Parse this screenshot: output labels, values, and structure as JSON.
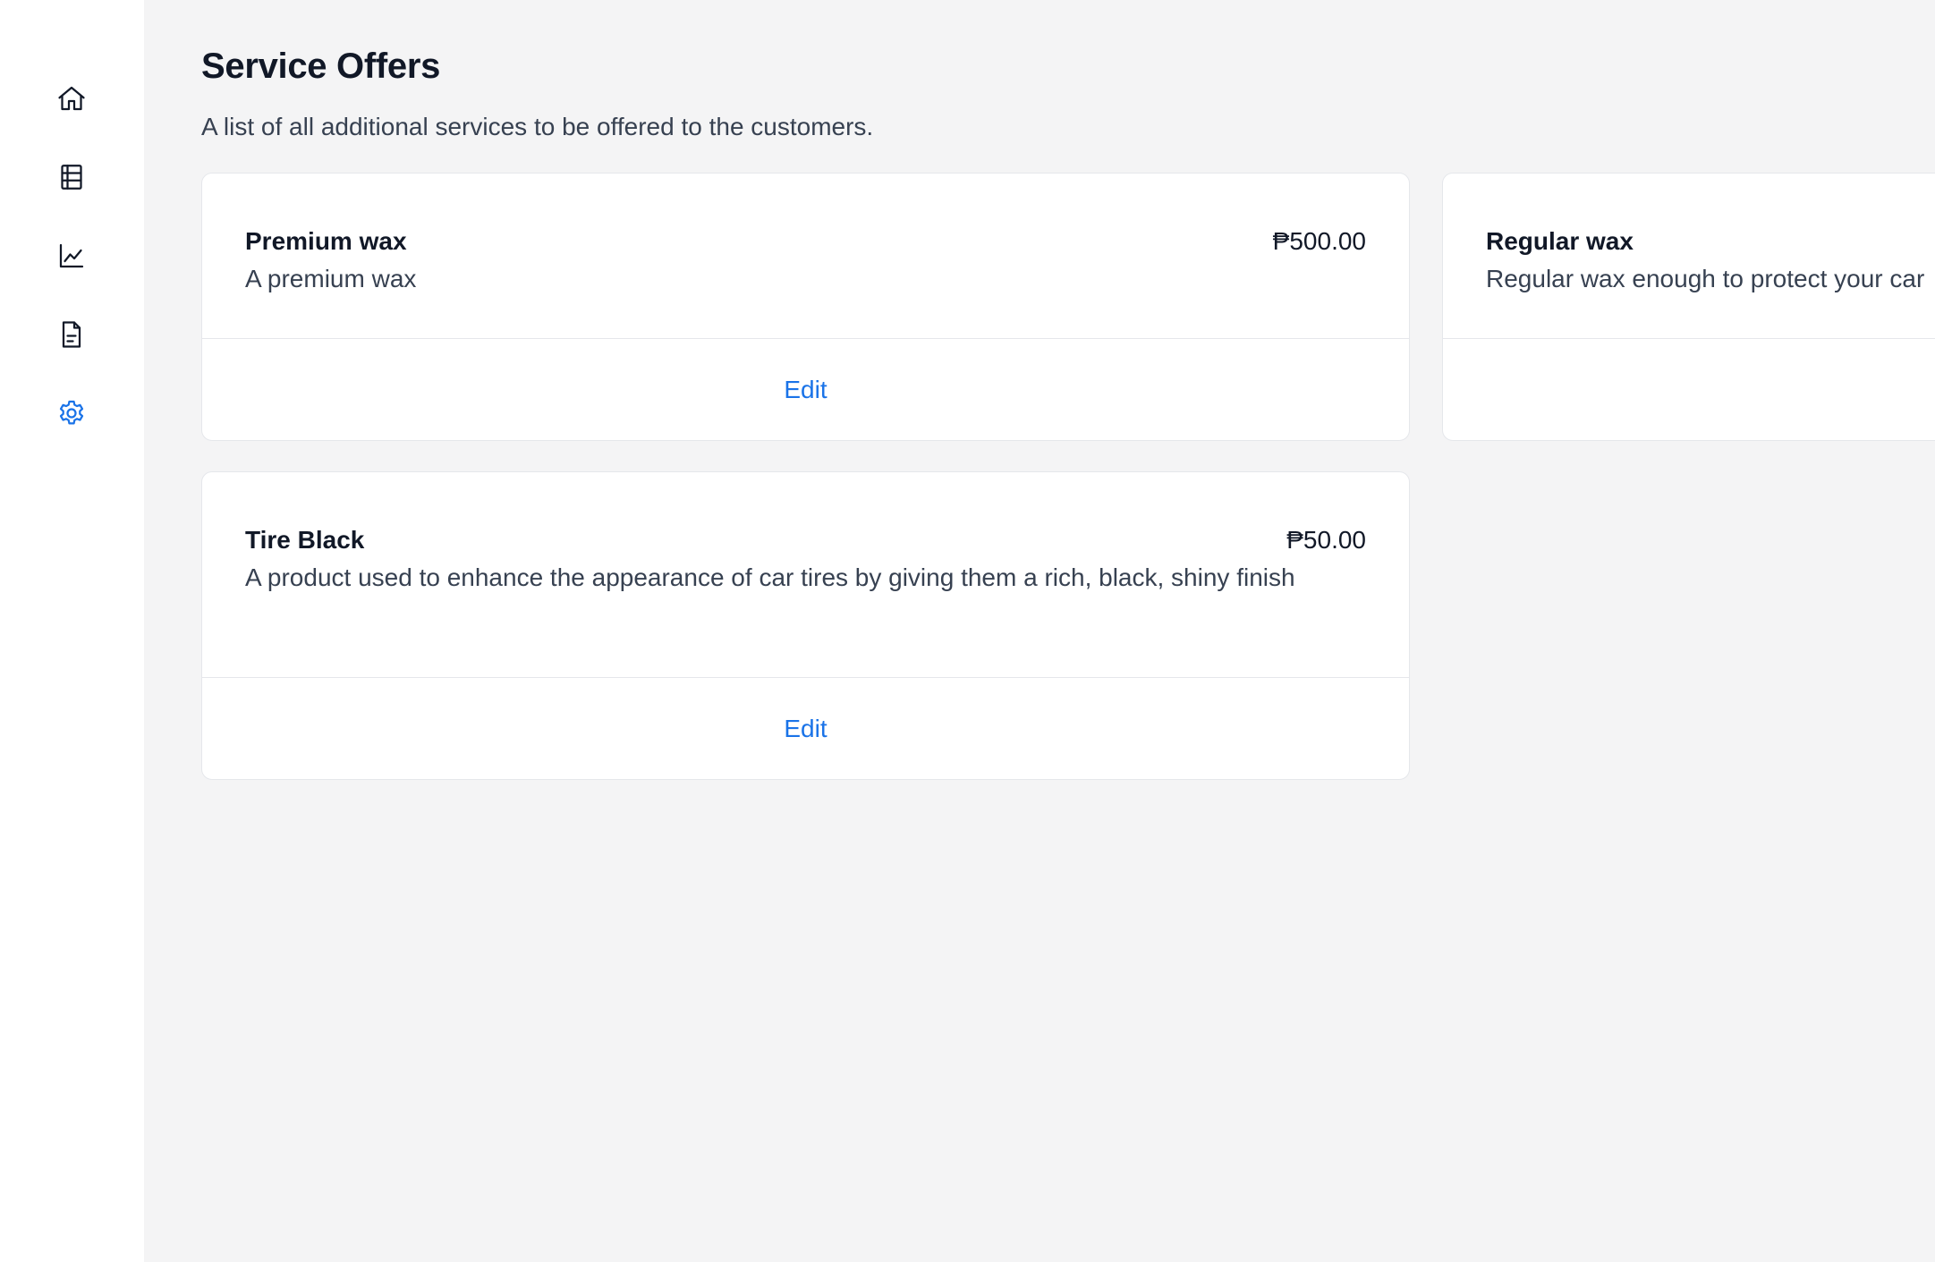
{
  "sidebar": {
    "items": [
      {
        "icon": "home-icon",
        "active": false
      },
      {
        "icon": "table-icon",
        "active": false
      },
      {
        "icon": "chart-icon",
        "active": false
      },
      {
        "icon": "document-icon",
        "active": false
      },
      {
        "icon": "gear-icon",
        "active": true
      }
    ],
    "active_color": "#1a73e8",
    "icon_color": "#111827"
  },
  "page": {
    "title": "Service Offers",
    "subtitle": "A list of all additional services to be offered to the customers."
  },
  "offers": [
    {
      "name": "Premium wax",
      "price": "₱500.00",
      "description": "A premium wax",
      "action": "Edit"
    },
    {
      "name": "Regular wax",
      "price": "",
      "description": "Regular wax enough to protect your car",
      "action": ""
    },
    {
      "name": "Tire Black",
      "price": "₱50.00",
      "description": "A product used to enhance the appearance of car tires by giving them a rich, black, shiny finish",
      "action": "Edit"
    }
  ]
}
